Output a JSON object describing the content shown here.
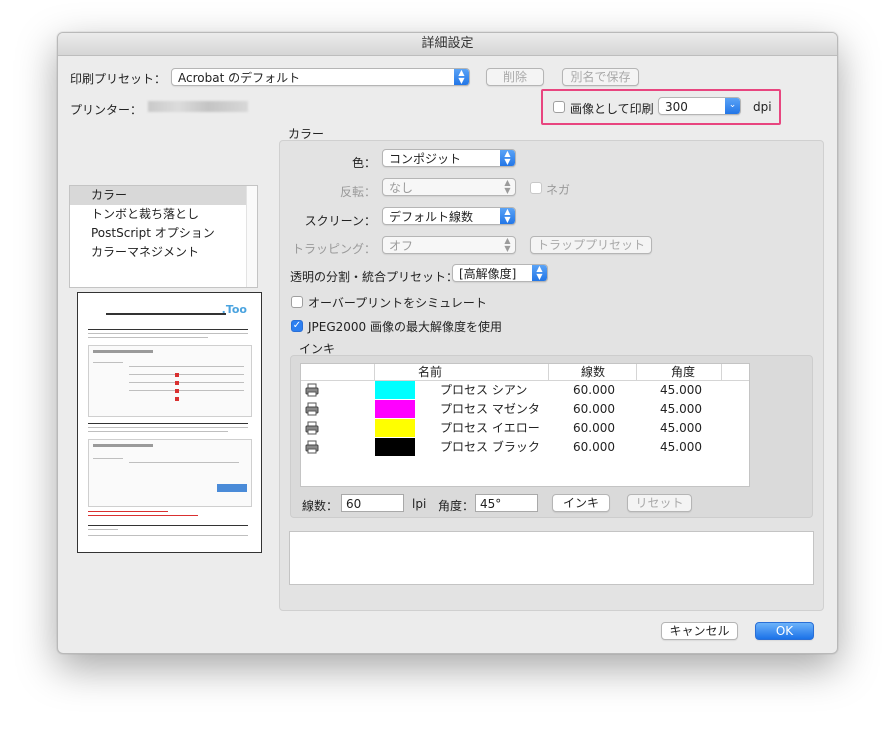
{
  "window": {
    "title": "詳細設定"
  },
  "preset": {
    "label": "印刷プリセット：",
    "value": "Acrobat のデフォルト",
    "delete_label": "削除",
    "save_as_label": "別名で保存"
  },
  "printer": {
    "label": "プリンター："
  },
  "image_print": {
    "checkbox_label": "画像として印刷",
    "dpi_value": "300",
    "dpi_unit": "dpi",
    "highlight_color": "#e8457f"
  },
  "sidebar": {
    "items": [
      {
        "label": "カラー",
        "selected": true
      },
      {
        "label": "トンボと裁ち落とし"
      },
      {
        "label": "PostScript オプション"
      },
      {
        "label": "カラーマネジメント"
      }
    ]
  },
  "color_section": {
    "title": "カラー",
    "color_label": "色：",
    "color_value": "コンポジット",
    "flip_label": "反転：",
    "flip_value": "なし",
    "negative_label": "ネガ",
    "screen_label": "スクリーン：",
    "screen_value": "デフォルト線数",
    "trapping_label": "トラッピング：",
    "trapping_value": "オフ",
    "trap_preset_label": "トラッププリセット",
    "transparency_label": "透明の分割・統合プリセット：",
    "transparency_value": "[高解像度]",
    "overprint_label": "オーバープリントをシミュレート",
    "jpeg2000_label": "JPEG2000 画像の最大解像度を使用"
  },
  "inks": {
    "title": "インキ",
    "columns": [
      "名前",
      "線数",
      "角度"
    ],
    "rows": [
      {
        "name": "プロセス シアン",
        "color": "#00ffff",
        "lpi": "60.000",
        "angle": "45.000"
      },
      {
        "name": "プロセス マゼンタ",
        "color": "#ff00ff",
        "lpi": "60.000",
        "angle": "45.000"
      },
      {
        "name": "プロセス イエロー",
        "color": "#ffff00",
        "lpi": "60.000",
        "angle": "45.000"
      },
      {
        "name": "プロセス ブラック",
        "color": "#000000",
        "lpi": "60.000",
        "angle": "45.000"
      }
    ],
    "lpi_label": "線数：",
    "lpi_value": "60",
    "lpi_unit": "lpi",
    "angle_label": "角度：",
    "angle_value": "45°",
    "ink_button_label": "インキ",
    "reset_button_label": "リセット"
  },
  "footer": {
    "cancel_label": "キャンセル",
    "ok_label": "OK"
  },
  "accent_color": "#1f73e6"
}
